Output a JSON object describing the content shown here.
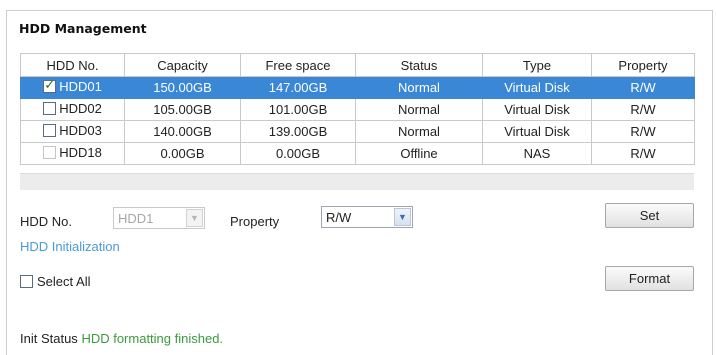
{
  "section": {
    "title": "HDD Management"
  },
  "table": {
    "headers": [
      "HDD No.",
      "Capacity",
      "Free space",
      "Status",
      "Type",
      "Property"
    ],
    "rows": [
      {
        "hdd": "HDD01",
        "capacity": "150.00GB",
        "free": "147.00GB",
        "status": "Normal",
        "type": "Virtual Disk",
        "property": "R/W",
        "checked": true,
        "selected": true
      },
      {
        "hdd": "HDD02",
        "capacity": "105.00GB",
        "free": "101.00GB",
        "status": "Normal",
        "type": "Virtual Disk",
        "property": "R/W",
        "checked": false,
        "selected": false
      },
      {
        "hdd": "HDD03",
        "capacity": "140.00GB",
        "free": "139.00GB",
        "status": "Normal",
        "type": "Virtual Disk",
        "property": "R/W",
        "checked": false,
        "selected": false
      },
      {
        "hdd": "HDD18",
        "capacity": "0.00GB",
        "free": "0.00GB",
        "status": "Offline",
        "type": "NAS",
        "property": "R/W",
        "checked": false,
        "selected": false,
        "disabled": true
      }
    ]
  },
  "controls": {
    "hdd_no_label": "HDD No.",
    "hdd_no_value": "HDD1",
    "property_label": "Property",
    "property_value": "R/W",
    "set_button": "Set",
    "hdd_init_link": "HDD Initialization",
    "select_all_label": "Select All",
    "format_button": "Format",
    "init_status_label": "Init Status",
    "init_status_value": "HDD formatting finished."
  },
  "colors": {
    "selected_row": "#3a87d6",
    "link": "#4a9ad6",
    "status_ok": "#3d9a3d"
  }
}
